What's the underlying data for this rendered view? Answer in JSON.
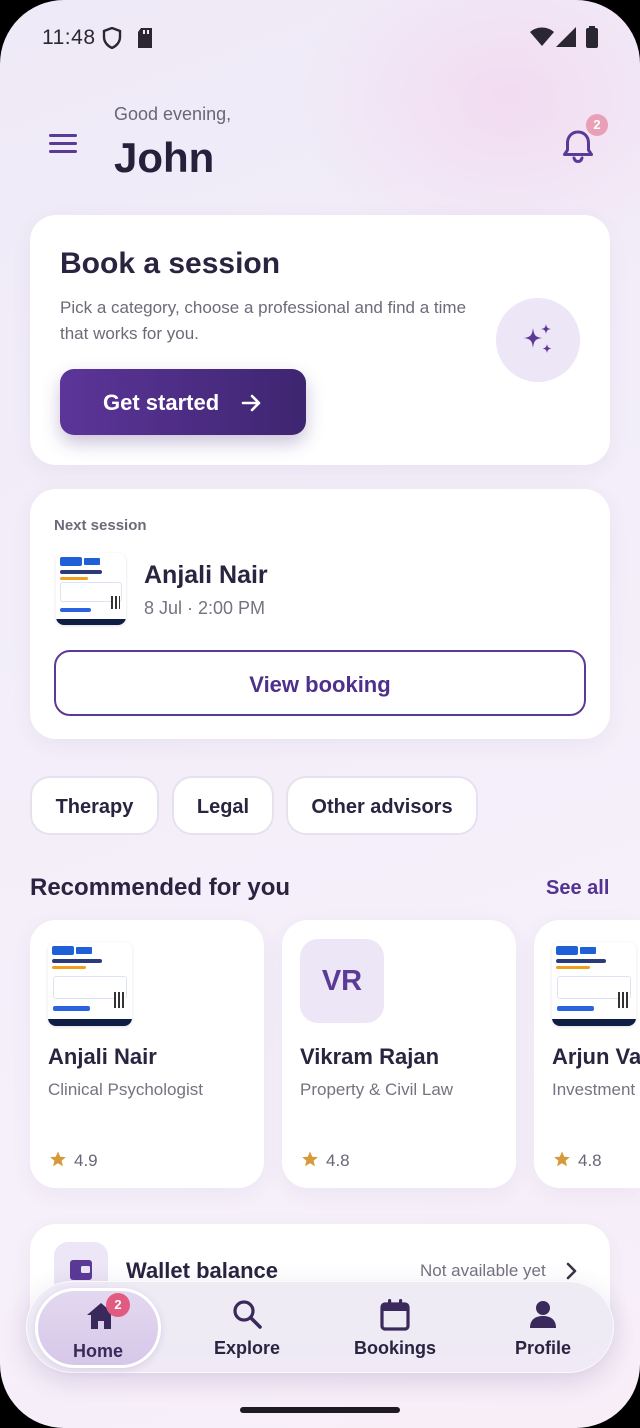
{
  "status_bar": {
    "time": "11:48",
    "left_icons": [
      "shield-icon",
      "sd-card-icon"
    ],
    "right_icons": [
      "wifi-icon",
      "signal-icon",
      "battery-icon"
    ]
  },
  "header": {
    "greeting": "Good evening,",
    "user_name": "John",
    "notification_count": "2"
  },
  "book_session": {
    "title": "Book a session",
    "description": "Pick a category, choose a professional and find a time that works for you.",
    "cta_label": "Get started",
    "icon": "sparkles-icon"
  },
  "next_session": {
    "label": "Next session",
    "name": "Anjali Nair",
    "datetime": "8 Jul · 2:00 PM",
    "button_label": "View booking"
  },
  "categories": [
    {
      "label": "Therapy"
    },
    {
      "label": "Legal"
    },
    {
      "label": "Other advisors"
    }
  ],
  "recommended": {
    "title": "Recommended for you",
    "see_all_label": "See all",
    "items": [
      {
        "name": "Anjali Nair",
        "role": "Clinical Psychologist",
        "rating": "4.9",
        "avatar": "photo"
      },
      {
        "name": "Vikram Rajan",
        "role": "Property & Civil Law",
        "rating": "4.8",
        "initials": "VR"
      },
      {
        "name": "Arjun Va",
        "role": "Investment",
        "rating": "4.8",
        "avatar": "photo"
      }
    ]
  },
  "wallet": {
    "title": "Wallet balance",
    "status": "Not available yet"
  },
  "bottom_nav": {
    "items": [
      {
        "label": "Home",
        "icon": "home-icon",
        "badge": "2",
        "active": true
      },
      {
        "label": "Explore",
        "icon": "search-icon"
      },
      {
        "label": "Bookings",
        "icon": "calendar-icon"
      },
      {
        "label": "Profile",
        "icon": "person-icon"
      }
    ]
  },
  "colors": {
    "accent": "#5b3a97",
    "text_primary": "#2a2440",
    "star": "#d69a3a",
    "badge": "#e15a80"
  }
}
